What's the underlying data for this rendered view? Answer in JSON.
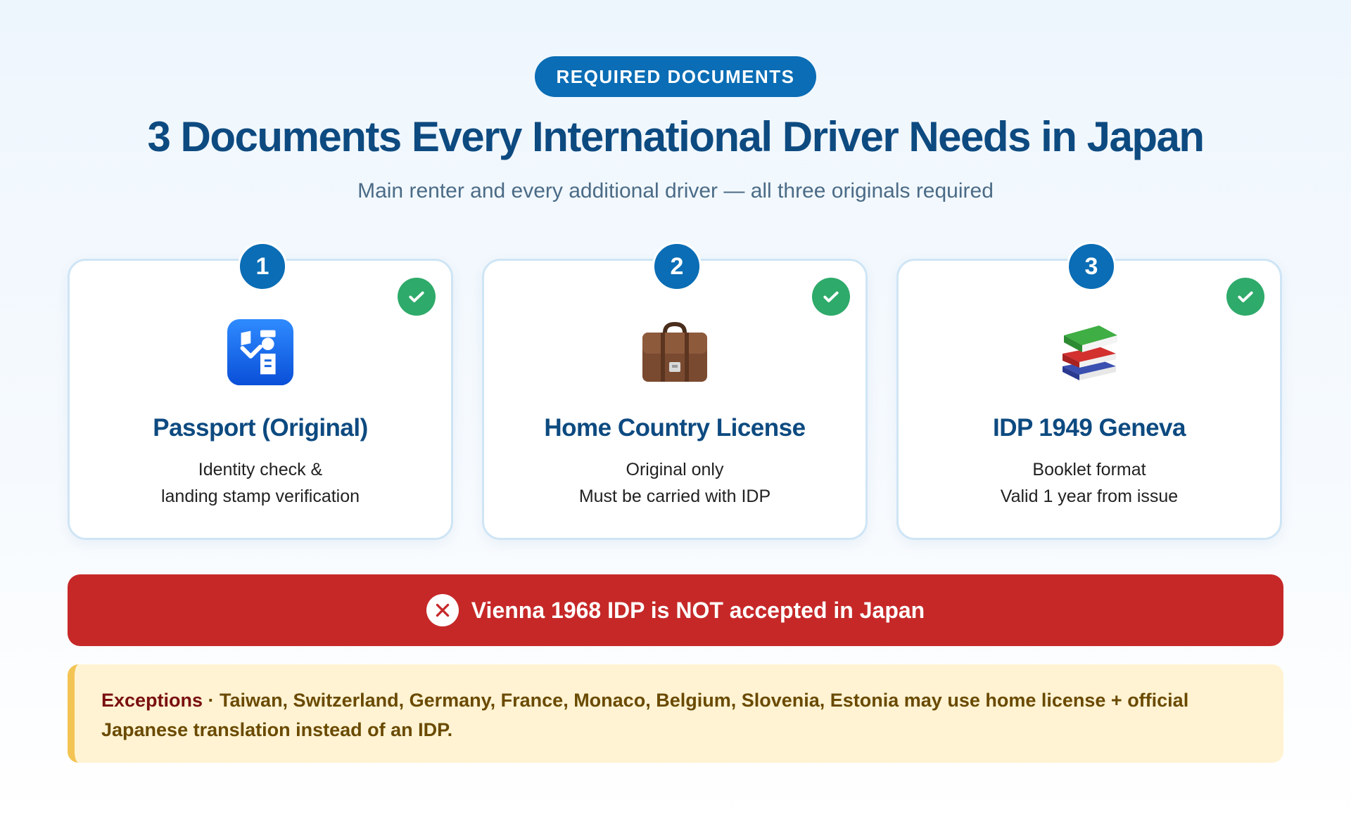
{
  "header": {
    "badge": "REQUIRED DOCUMENTS",
    "title": "3 Documents Every International Driver Needs in Japan",
    "subtitle": "Main renter and every additional driver — all three originals required"
  },
  "cards": [
    {
      "number": "1",
      "icon": "passport-control-icon",
      "title": "Passport (Original)",
      "desc_line1": "Identity check &",
      "desc_line2": "landing stamp verification"
    },
    {
      "number": "2",
      "icon": "briefcase-icon",
      "title": "Home Country License",
      "desc_line1": "Original only",
      "desc_line2": "Must be carried with IDP"
    },
    {
      "number": "3",
      "icon": "books-icon",
      "title": "IDP 1949 Geneva",
      "desc_line1": "Booklet format",
      "desc_line2": "Valid 1 year from issue"
    }
  ],
  "alert": {
    "text": "Vienna 1968 IDP is NOT accepted in Japan"
  },
  "exceptions": {
    "label": "Exceptions",
    "text": " · Taiwan, Switzerland, Germany, France, Monaco, Belgium, Slovenia, Estonia may use home license + official Japanese translation instead of an IDP."
  },
  "colors": {
    "primary": "#0a6db5",
    "title": "#0d4a80",
    "success": "#2eaa6a",
    "danger": "#c62828",
    "warning_bg": "#fff3d3",
    "warning_border": "#f3c453"
  }
}
